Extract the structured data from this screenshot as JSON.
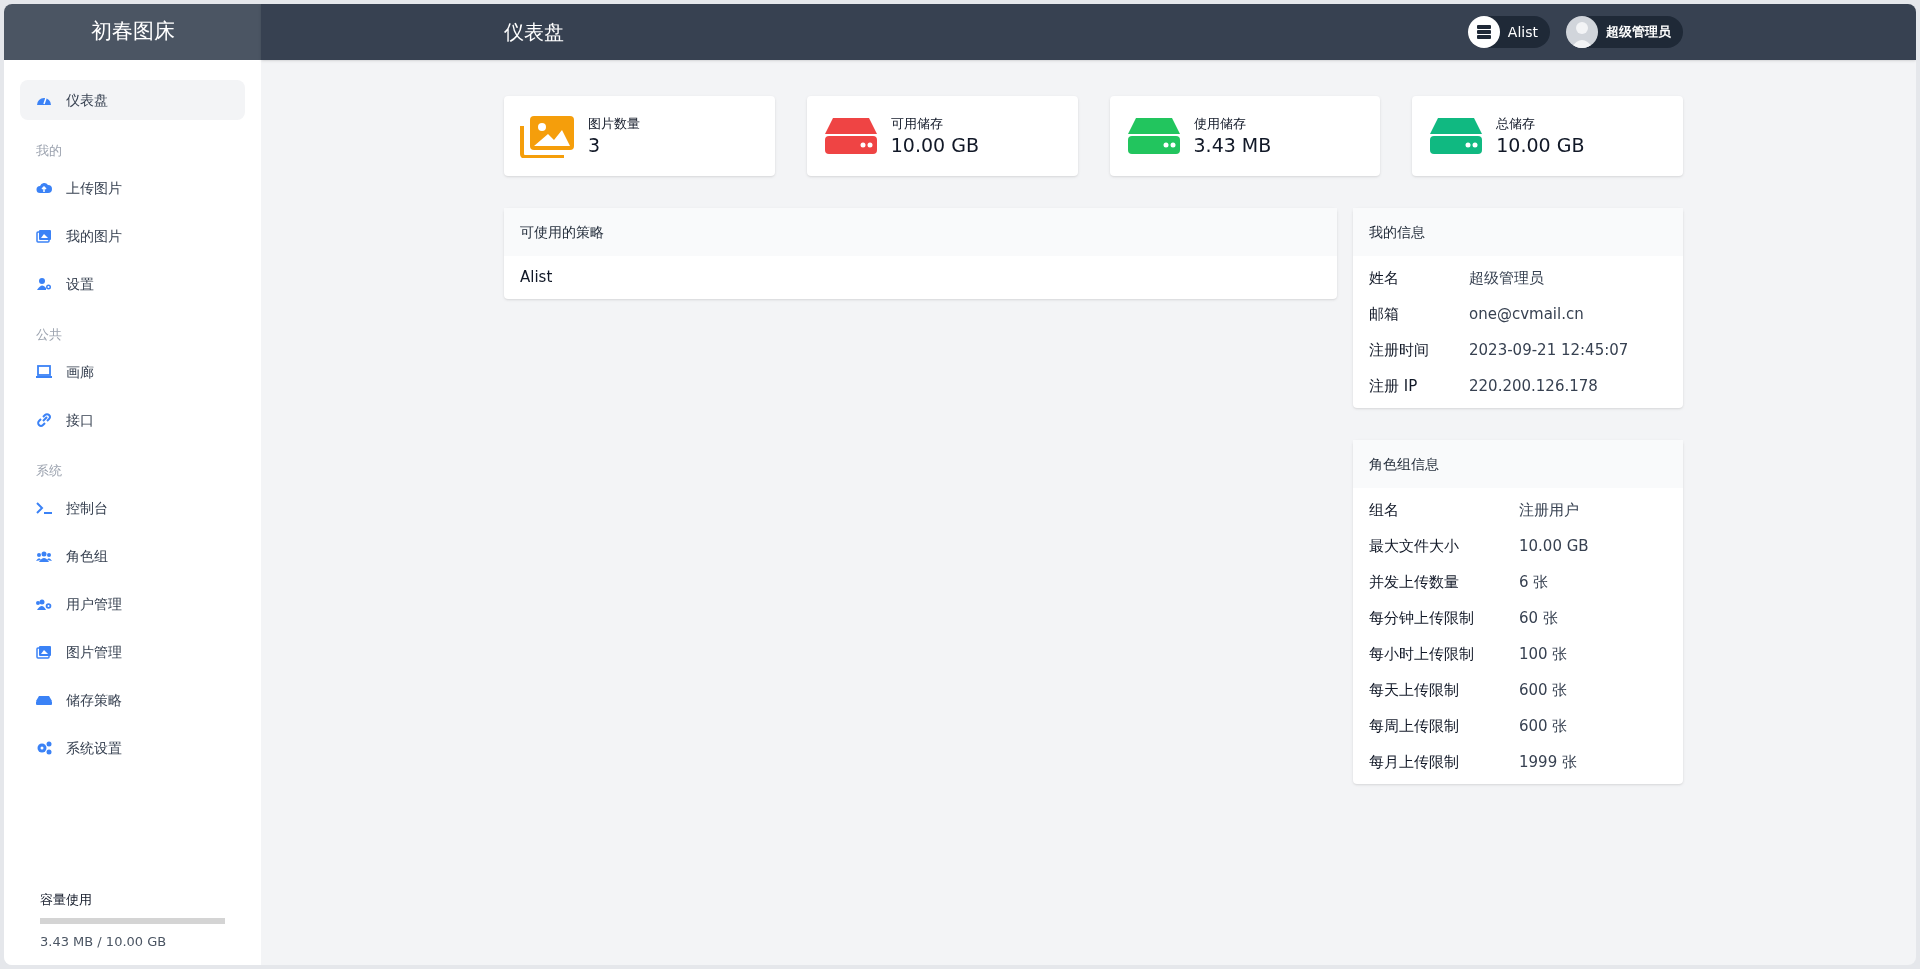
{
  "app": {
    "title": "初春图床"
  },
  "header": {
    "title": "仪表盘",
    "storage_badge": "Alist",
    "user_badge": "超级管理员"
  },
  "sidebar": {
    "items": [
      {
        "kind": "item",
        "label": "仪表盘",
        "selected": true
      },
      {
        "kind": "heading",
        "label": "我的"
      },
      {
        "kind": "item",
        "label": "上传图片",
        "selected": false
      },
      {
        "kind": "item",
        "label": "我的图片",
        "selected": false
      },
      {
        "kind": "item",
        "label": "设置",
        "selected": false
      },
      {
        "kind": "heading",
        "label": "公共"
      },
      {
        "kind": "item",
        "label": "画廊",
        "selected": false
      },
      {
        "kind": "item",
        "label": "接口",
        "selected": false
      },
      {
        "kind": "heading",
        "label": "系统"
      },
      {
        "kind": "item",
        "label": "控制台",
        "selected": false
      },
      {
        "kind": "item",
        "label": "角色组",
        "selected": false
      },
      {
        "kind": "item",
        "label": "用户管理",
        "selected": false
      },
      {
        "kind": "item",
        "label": "图片管理",
        "selected": false
      },
      {
        "kind": "item",
        "label": "储存策略",
        "selected": false
      },
      {
        "kind": "item",
        "label": "系统设置",
        "selected": false
      }
    ],
    "capacity": {
      "label": "容量使用",
      "level": 0.0003,
      "reading": "3.43 MB / 10.00 GB"
    }
  },
  "stats": [
    {
      "kind": "images",
      "color": "#f59e0b",
      "label": "图片数量",
      "value": "3"
    },
    {
      "kind": "drive",
      "color": "#ef4444",
      "label": "可用储存",
      "value": "10.00 GB"
    },
    {
      "kind": "drive",
      "color": "#22c55e",
      "label": "使用储存",
      "value": "3.43 MB"
    },
    {
      "kind": "drive",
      "color": "#10b981",
      "label": "总储存",
      "value": "10.00 GB"
    }
  ],
  "policies": {
    "title": "可使用的策略",
    "items": [
      "Alist"
    ]
  },
  "my_info": {
    "title": "我的信息",
    "rows": [
      {
        "label": "姓名",
        "value": "超级管理员"
      },
      {
        "label": "邮箱",
        "value": "one@cvmail.cn"
      },
      {
        "label": "注册时间",
        "value": "2023-09-21 12:45:07"
      },
      {
        "label": "注册 IP",
        "value": "220.200.126.178"
      }
    ]
  },
  "group_info": {
    "title": "角色组信息",
    "rows": [
      {
        "label": "组名",
        "value": "注册用户"
      },
      {
        "label": "最大文件大小",
        "value": "10.00 GB"
      },
      {
        "label": "并发上传数量",
        "value": "6 张"
      },
      {
        "label": "每分钟上传限制",
        "value": "60 张"
      },
      {
        "label": "每小时上传限制",
        "value": "100 张"
      },
      {
        "label": "每天上传限制",
        "value": "600 张"
      },
      {
        "label": "每周上传限制",
        "value": "600 张"
      },
      {
        "label": "每月上传限制",
        "value": "1999 张"
      }
    ]
  }
}
